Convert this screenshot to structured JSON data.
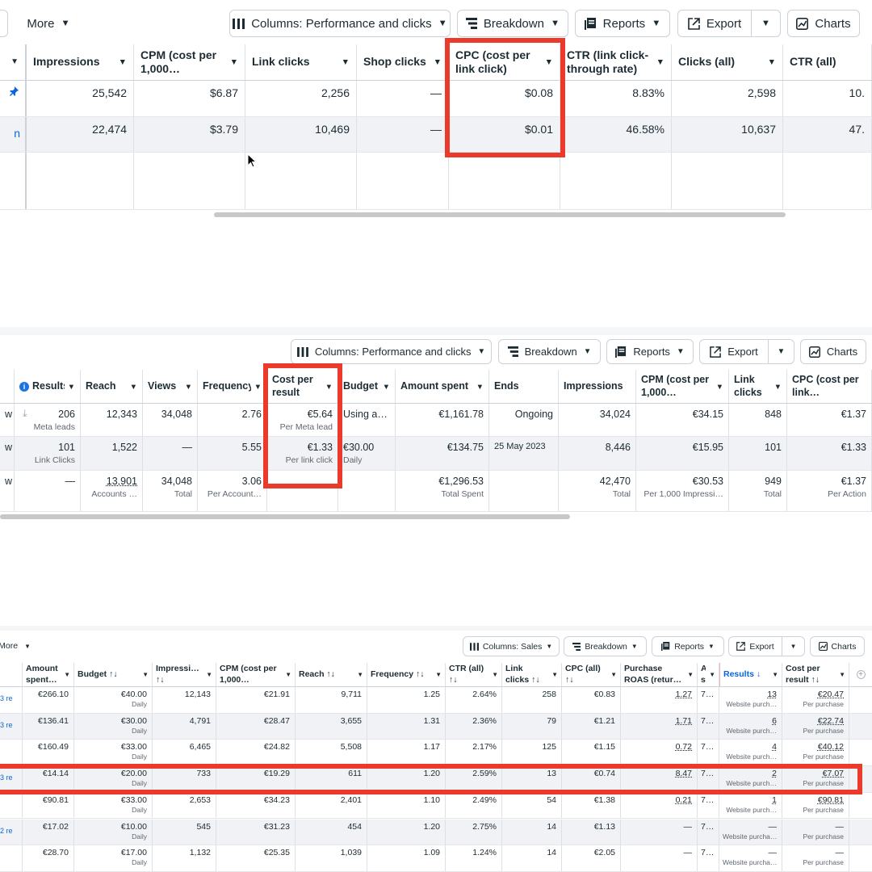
{
  "colors": {
    "highlight": "#ea3a2b",
    "link_blue": "#0a66d8",
    "row_alt": "#f0f2f5"
  },
  "panel1": {
    "toolbar": {
      "more": "More",
      "columns": "Columns: Performance and clicks",
      "breakdown": "Breakdown",
      "reports": "Reports",
      "export": "Export",
      "charts": "Charts"
    },
    "headers": [
      "Impressions",
      "CPM (cost per 1,000…",
      "Link clicks",
      "Shop clicks",
      "CPC (cost per link click)",
      "CTR (link click-through rate)",
      "Clicks (all)",
      "CTR (all)"
    ],
    "rows": [
      [
        "25,542",
        "$6.87",
        "2,256",
        "—",
        "$0.08",
        "8.83%",
        "2,598",
        "10."
      ],
      [
        "22,474",
        "$3.79",
        "10,469",
        "—",
        "$0.01",
        "46.58%",
        "10,637",
        "47."
      ]
    ]
  },
  "panel2": {
    "toolbar": {
      "columns": "Columns: Performance and clicks",
      "breakdown": "Breakdown",
      "reports": "Reports",
      "export": "Export",
      "charts": "Charts"
    },
    "headers": [
      "Results",
      "Reach",
      "Views",
      "Frequency",
      "Cost per result",
      "Budget",
      "Amount spent",
      "Ends",
      "Impressions",
      "CPM (cost per 1,000…",
      "Link clicks",
      "CPC (cost per link…"
    ],
    "rows": [
      {
        "lead": "w",
        "cells": [
          {
            "v": "206",
            "s": "Meta leads"
          },
          {
            "v": "12,343",
            "s": ""
          },
          {
            "v": "34,048",
            "s": ""
          },
          {
            "v": "2.76",
            "s": ""
          },
          {
            "v": "€5.64",
            "s": "Per Meta lead"
          },
          {
            "v": "Using a…",
            "s": ""
          },
          {
            "v": "€1,161.78",
            "s": ""
          },
          {
            "v": "Ongoing",
            "s": ""
          },
          {
            "v": "34,024",
            "s": ""
          },
          {
            "v": "€34.15",
            "s": ""
          },
          {
            "v": "848",
            "s": ""
          },
          {
            "v": "€1.37",
            "s": ""
          }
        ]
      },
      {
        "lead": "w",
        "cells": [
          {
            "v": "101",
            "s": "Link Clicks"
          },
          {
            "v": "1,522",
            "s": ""
          },
          {
            "v": "—",
            "s": ""
          },
          {
            "v": "5.55",
            "s": ""
          },
          {
            "v": "€1.33",
            "s": "Per link click"
          },
          {
            "v": "€30.00",
            "s": "Daily"
          },
          {
            "v": "€134.75",
            "s": ""
          },
          {
            "v": "25 May 2023",
            "s": ""
          },
          {
            "v": "8,446",
            "s": ""
          },
          {
            "v": "€15.95",
            "s": ""
          },
          {
            "v": "101",
            "s": ""
          },
          {
            "v": "€1.33",
            "s": ""
          }
        ]
      },
      {
        "lead": "w",
        "cells": [
          {
            "v": "—",
            "s": ""
          },
          {
            "v": "13,901",
            "s": "Accounts …"
          },
          {
            "v": "34,048",
            "s": "Total"
          },
          {
            "v": "3.06",
            "s": "Per Account…"
          },
          {
            "v": "",
            "s": ""
          },
          {
            "v": "",
            "s": ""
          },
          {
            "v": "€1,296.53",
            "s": "Total Spent"
          },
          {
            "v": "",
            "s": ""
          },
          {
            "v": "42,470",
            "s": "Total"
          },
          {
            "v": "€30.53",
            "s": "Per 1,000 Impressi…"
          },
          {
            "v": "949",
            "s": "Total"
          },
          {
            "v": "€1.37",
            "s": "Per Action"
          }
        ]
      }
    ]
  },
  "panel3": {
    "toolbar": {
      "more": "More",
      "columns": "Columns: Sales",
      "breakdown": "Breakdown",
      "reports": "Reports",
      "export": "Export",
      "charts": "Charts"
    },
    "headers": [
      "Amount spent…",
      "Budget ↑↓",
      "Impressi… ↑↓",
      "CPM (cost per 1,000…",
      "Reach ↑↓",
      "Frequency ↑↓",
      "CTR (all) ↑↓",
      "Link clicks ↑↓",
      "CPC (all) ↑↓",
      "Purchase ROAS (retur…",
      "A… s…",
      "Results ↓",
      "Cost per result ↑↓"
    ],
    "lead_label": "3 re",
    "lead_label_alt": "2 re",
    "budget_sub": "Daily",
    "results_sub": "Website purch…",
    "results_sub_alt": "Website purcha…",
    "cpr_sub": "Per purchase",
    "rows": [
      [
        "€266.10",
        "€40.00",
        "12,143",
        "€21.91",
        "9,711",
        "1.25",
        "2.64%",
        "258",
        "€0.83",
        "1.27",
        "7…",
        "13",
        "€20.47"
      ],
      [
        "€136.41",
        "€30.00",
        "4,791",
        "€28.47",
        "3,655",
        "1.31",
        "2.36%",
        "79",
        "€1.21",
        "1.71",
        "7…",
        "6",
        "€22.74"
      ],
      [
        "€160.49",
        "€33.00",
        "6,465",
        "€24.82",
        "5,508",
        "1.17",
        "2.17%",
        "125",
        "€1.15",
        "0.72",
        "7…",
        "4",
        "€40.12"
      ],
      [
        "€14.14",
        "€20.00",
        "733",
        "€19.29",
        "611",
        "1.20",
        "2.59%",
        "13",
        "€0.74",
        "8.47",
        "7…",
        "2",
        "€7.07"
      ],
      [
        "€90.81",
        "€33.00",
        "2,653",
        "€34.23",
        "2,401",
        "1.10",
        "2.49%",
        "54",
        "€1.38",
        "0.21",
        "7…",
        "1",
        "€90.81"
      ],
      [
        "€17.02",
        "€10.00",
        "545",
        "€31.23",
        "454",
        "1.20",
        "2.75%",
        "14",
        "€1.13",
        "—",
        "7…",
        "—",
        "—"
      ],
      [
        "€28.70",
        "€17.00",
        "1,132",
        "€25.35",
        "1,039",
        "1.09",
        "1.24%",
        "14",
        "€2.05",
        "—",
        "7…",
        "—",
        "—"
      ]
    ]
  }
}
